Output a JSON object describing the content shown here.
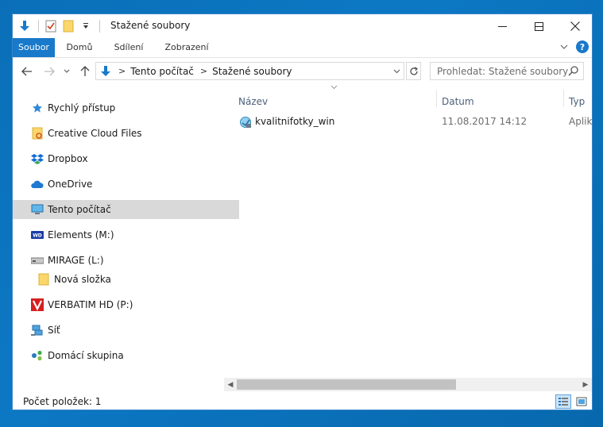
{
  "window": {
    "title": "Stažené soubory",
    "controls": [
      "minimize",
      "maximize",
      "close"
    ]
  },
  "ribbon": {
    "tabs": [
      {
        "label": "Soubor"
      },
      {
        "label": "Domů"
      },
      {
        "label": "Sdílení"
      },
      {
        "label": "Zobrazení"
      }
    ]
  },
  "address": {
    "segments": [
      "Tento počítač",
      "Stažené soubory"
    ]
  },
  "search": {
    "placeholder": "Prohledat: Stažené soubory"
  },
  "sidebar": {
    "items": [
      {
        "label": "Rychlý přístup",
        "icon": "star-icon"
      },
      {
        "label": "Creative Cloud Files",
        "icon": "creative-cloud-folder-icon"
      },
      {
        "label": "Dropbox",
        "icon": "dropbox-icon"
      },
      {
        "label": "OneDrive",
        "icon": "onedrive-icon"
      },
      {
        "label": "Tento počítač",
        "icon": "computer-icon",
        "selected": true
      },
      {
        "label": "Elements (M:)",
        "icon": "wd-drive-icon"
      },
      {
        "label": "MIRAGE (L:)",
        "icon": "drive-icon"
      },
      {
        "label": "Nová složka",
        "icon": "folder-icon"
      },
      {
        "label": "VERBATIM HD (P:)",
        "icon": "verbatim-drive-icon"
      },
      {
        "label": "Síť",
        "icon": "network-icon"
      },
      {
        "label": "Domácí skupina",
        "icon": "homegroup-icon"
      }
    ]
  },
  "columns": [
    "Název",
    "Datum",
    "Typ"
  ],
  "files": [
    {
      "name": "kvalitnifotky_win",
      "date": "11.08.2017 14:12",
      "type": "Aplika"
    }
  ],
  "status": {
    "text": "Počet položek: 1"
  },
  "colors": {
    "accent": "#1979ca",
    "selection": "#d9d9d9",
    "header_text": "#4c607a"
  }
}
